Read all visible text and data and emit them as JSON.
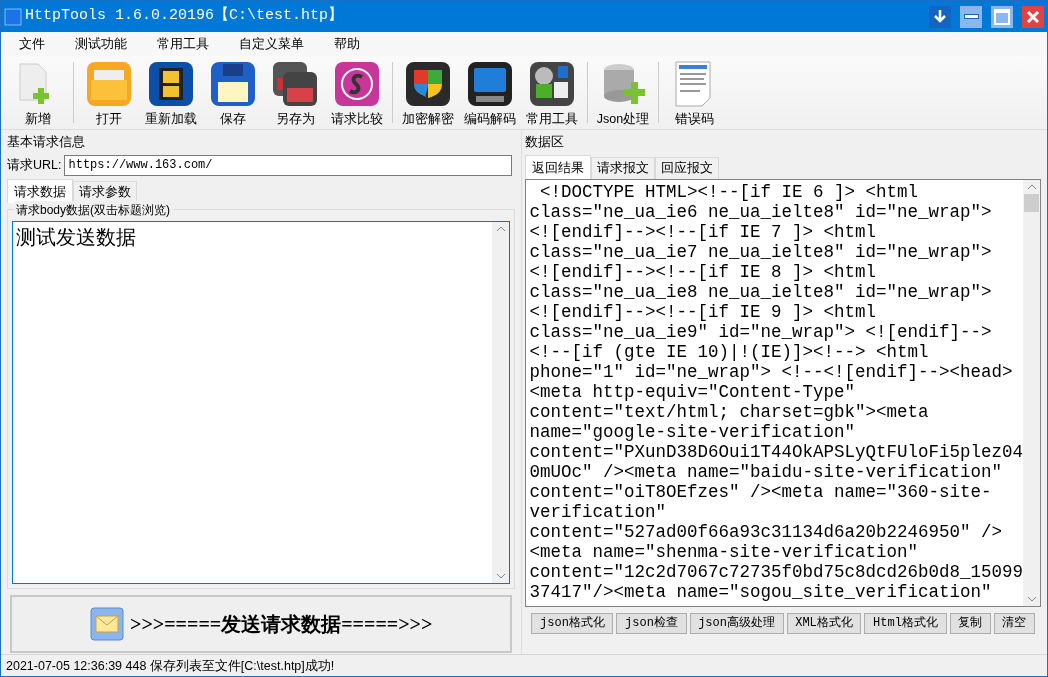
{
  "window": {
    "title": "HttpTools 1.6.0.20196【C:\\test.htp】"
  },
  "menu": [
    "文件",
    "测试功能",
    "常用工具",
    "自定义菜单",
    "帮助"
  ],
  "toolbar": [
    {
      "buttons": [
        {
          "label": "新增"
        }
      ]
    },
    {
      "buttons": [
        {
          "label": "打开"
        },
        {
          "label": "重新加载"
        },
        {
          "label": "保存"
        },
        {
          "label": "另存为"
        },
        {
          "label": "请求比较"
        }
      ]
    },
    {
      "buttons": [
        {
          "label": "加密解密"
        },
        {
          "label": "编码解码"
        },
        {
          "label": "常用工具"
        }
      ]
    },
    {
      "buttons": [
        {
          "label": "Json处理"
        }
      ]
    },
    {
      "buttons": [
        {
          "label": "错误码"
        }
      ]
    }
  ],
  "request_info": {
    "title": "基本请求信息",
    "url_label": "请求URL:",
    "url": "https://www.163.com/"
  },
  "request_tabs": [
    {
      "label": "请求数据",
      "selected": true
    },
    {
      "label": "请求参数",
      "selected": false
    }
  ],
  "body": {
    "title": "请求body数据(双击标题浏览)",
    "value": "测试发送数据"
  },
  "send_button": ">>>=====发送请求数据=====>>>",
  "data_area": {
    "title": "数据区",
    "tabs": [
      {
        "label": "返回结果",
        "selected": true
      },
      {
        "label": "请求报文",
        "selected": false
      },
      {
        "label": "回应报文",
        "selected": false
      }
    ],
    "lines": [
      " <!DOCTYPE HTML><!--[if IE 6 ]> <html",
      "class=\"ne_ua_ie6 ne_ua_ielte8\" id=\"ne_wrap\">",
      "<![endif]--><!--[if IE 7 ]> <html",
      "class=\"ne_ua_ie7 ne_ua_ielte8\" id=\"ne_wrap\">",
      "<![endif]--><!--[if IE 8 ]> <html",
      "class=\"ne_ua_ie8 ne_ua_ielte8\" id=\"ne_wrap\">",
      "<![endif]--><!--[if IE 9 ]> <html",
      "class=\"ne_ua_ie9\" id=\"ne_wrap\"> <![endif]-->",
      "<!--[if (gte IE 10)|!(IE)]><!--> <html",
      "phone=\"1\" id=\"ne_wrap\"> <!--<![endif]--><head>",
      "<meta http-equiv=\"Content-Type\"",
      "content=\"text/html; charset=gbk\"><meta",
      "name=\"google-site-verification\"",
      "content=\"PXunD38D6Oui1T44OkAPSLyQtFUloFi5plez04",
      "0mUOc\" /><meta name=\"baidu-site-verification\"",
      "content=\"oiT8OEfzes\" /><meta name=\"360-site-",
      "verification\"",
      "content=\"527ad00f66a93c31134d6a20b2246950\" />",
      "<meta name=\"shenma-site-verification\"",
      "content=\"12c2d7067c72735f0bd75c8dcd26b0d8_15099",
      "37417\"/><meta name=\"sogou_site_verification\""
    ],
    "buttons": [
      "json格式化",
      "json检查",
      "json高级处理",
      "XML格式化",
      "Html格式化",
      "复制",
      "清空"
    ]
  },
  "status_bar": "2021-07-05 12:36:39 448 保存列表至文件[C:\\test.htp]成功!"
}
